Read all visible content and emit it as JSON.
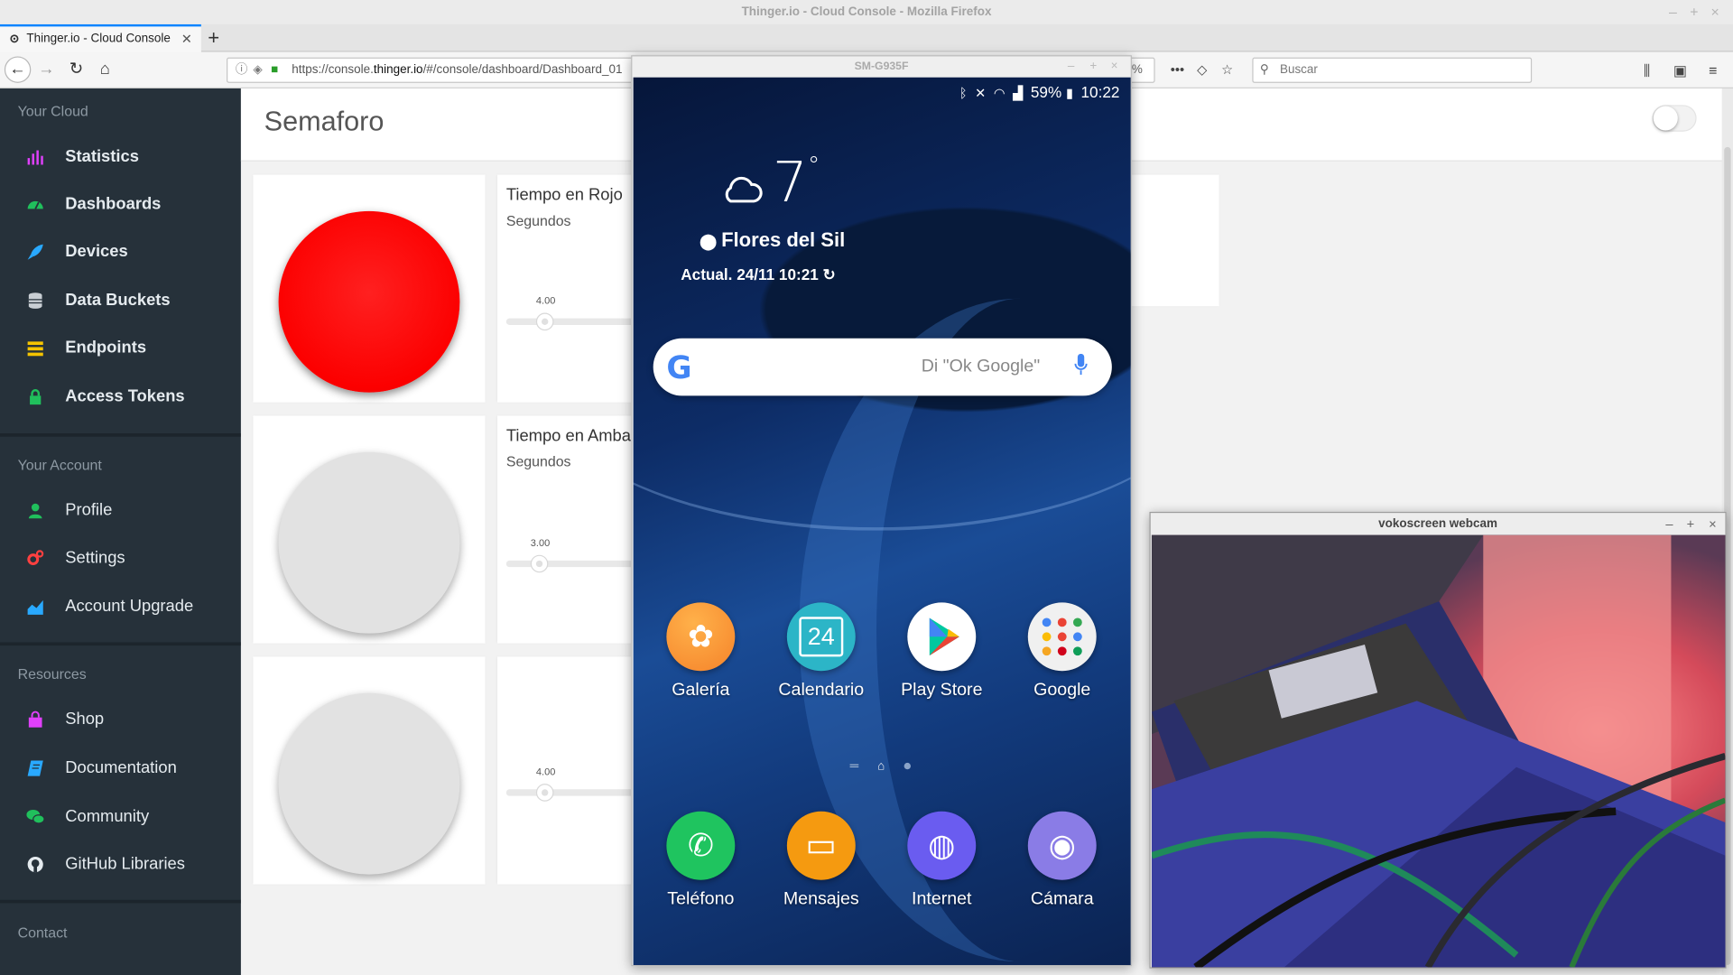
{
  "window_title": "Thinger.io - Cloud Console - Mozilla Firefox",
  "tab": {
    "label": "Thinger.io - Cloud Console"
  },
  "url": {
    "prefix": "https://console.",
    "domain": "thinger.io",
    "path": "/#/console/dashboard/Dashboard_01",
    "zoom_fragment": "%"
  },
  "search": {
    "placeholder": "Buscar"
  },
  "sidebar": {
    "your_cloud": "Your Cloud",
    "cloud_items": [
      {
        "label": "Statistics",
        "icon": "bar-chart-icon",
        "color": "#e040fb"
      },
      {
        "label": "Dashboards",
        "icon": "dashboard-icon",
        "color": "#20c05c"
      },
      {
        "label": "Devices",
        "icon": "rocket-icon",
        "color": "#29a9ff"
      },
      {
        "label": "Data Buckets",
        "icon": "database-icon",
        "color": "#c8ced3"
      },
      {
        "label": "Endpoints",
        "icon": "endpoints-icon",
        "color": "#f5c400"
      },
      {
        "label": "Access Tokens",
        "icon": "lock-icon",
        "color": "#20c05c"
      }
    ],
    "your_account": "Your Account",
    "account_items": [
      {
        "label": "Profile",
        "icon": "user-icon",
        "color": "#20c05c"
      },
      {
        "label": "Settings",
        "icon": "cogs-icon",
        "color": "#ff4040"
      },
      {
        "label": "Account Upgrade",
        "icon": "area-chart-icon",
        "color": "#29a9ff"
      }
    ],
    "resources": "Resources",
    "resource_items": [
      {
        "label": "Shop",
        "icon": "shopping-bag-icon",
        "color": "#e040fb"
      },
      {
        "label": "Documentation",
        "icon": "book-icon",
        "color": "#29a9ff"
      },
      {
        "label": "Community",
        "icon": "comments-icon",
        "color": "#20c05c"
      },
      {
        "label": "GitHub Libraries",
        "icon": "github-icon",
        "color": "#e5ebef"
      }
    ],
    "contact": "Contact"
  },
  "dashboard": {
    "title": "Semaforo",
    "widgets": [
      {
        "led": "on",
        "led_color": "#fc0000",
        "title": "Tiempo en Rojo",
        "subtitle": "Segundos",
        "slider_value": "4.00",
        "slider_fraction": 0.3
      },
      {
        "led": "off",
        "led_color": "#e2e2e2",
        "title": "Tiempo en Amba",
        "subtitle": "Segundos",
        "slider_value": "3.00",
        "slider_fraction": 0.26
      },
      {
        "led": "off",
        "led_color": "#e2e2e2",
        "title": "",
        "subtitle": "",
        "slider_value": "4.00",
        "slider_fraction": 0.3
      }
    ]
  },
  "phone": {
    "window_title": "SM-G935F",
    "battery": "59%",
    "time": "10:22",
    "temperature": "7",
    "degree": "°",
    "location": "Flores del Sil",
    "updated": "Actual. 24/11 10:21",
    "search_hint": "Di \"Ok Google\"",
    "google_letter": "G",
    "apps_row1": [
      {
        "label": "Galería",
        "icon": "gallery-icon",
        "color": "#f7a23a"
      },
      {
        "label": "Calendario",
        "icon": "calendar-icon",
        "color": "#2cb5c7",
        "glyph": "24"
      },
      {
        "label": "Play Store",
        "icon": "play-store-icon",
        "color": "#ffffff"
      },
      {
        "label": "Google",
        "icon": "google-folder-icon",
        "color": "#f0f0f0"
      }
    ],
    "apps_row2": [
      {
        "label": "Teléfono",
        "icon": "phone-icon",
        "color": "#1fc45f"
      },
      {
        "label": "Mensajes",
        "icon": "messages-icon",
        "color": "#f59a10"
      },
      {
        "label": "Internet",
        "icon": "internet-icon",
        "color": "#6a5cf0"
      },
      {
        "label": "Cámara",
        "icon": "camera-icon",
        "color": "#8a7ce6"
      }
    ]
  },
  "webcam": {
    "window_title": "vokoscreen webcam"
  }
}
